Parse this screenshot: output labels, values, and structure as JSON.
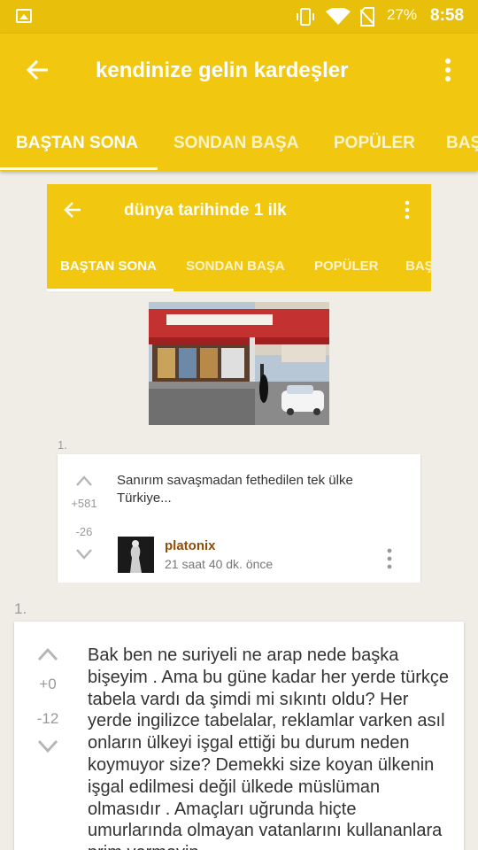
{
  "status_bar": {
    "battery": "27%",
    "time": "8:58"
  },
  "app_bar": {
    "title": "kendinize gelin kardeşler",
    "tabs": [
      "BAŞTAN SONA",
      "SONDAN BAŞA",
      "POPÜLER",
      "BAŞ"
    ]
  },
  "embedded": {
    "title": "dünya tarihinde 1 ilk",
    "tabs": [
      "BAŞTAN SONA",
      "SONDAN BAŞA",
      "POPÜLER",
      "BAŞ"
    ],
    "entry": {
      "number": "1.",
      "upvotes": "+581",
      "downvotes": "-26",
      "text": "Sanırım savaşmadan fethedilen tek ülke Türkiye...",
      "author": "platonix",
      "time_ago": "21 saat 40 dk. önce"
    }
  },
  "entry": {
    "number": "1.",
    "upvotes": "+0",
    "downvotes": "-12",
    "text": "Bak ben ne suriyeli ne arap nede başka bişeyim . Ama bu güne kadar her yerde türkçe tabela vardı da şimdi mi sıkıntı oldu? Her yerde ingilizce tabelalar, reklamlar varken asıl onların ülkeyi işgal ettiği bu durum neden koymuyor size? Demekki size koyan ülkenin işgal edilmesi değil ülkede müslüman olmasıdır . Amaçları uğrunda hiçte umurlarında olmayan vatanlarını kullananlara prim vermeyin."
  },
  "colors": {
    "accent": "#f1c80f",
    "background": "#efede6",
    "author": "#8d4d07"
  }
}
